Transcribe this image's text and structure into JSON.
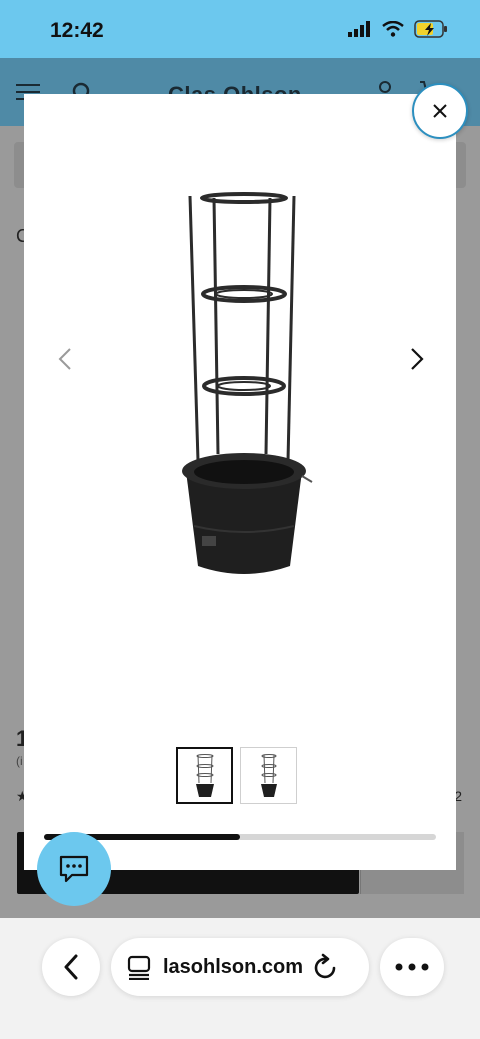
{
  "status_bar": {
    "time": "12:42",
    "icons": [
      "signal-icon",
      "wifi-icon",
      "battery-charging-icon"
    ]
  },
  "header": {
    "brand": "Clas Ohlson",
    "icons": [
      "menu-icon",
      "search-icon",
      "user-icon",
      "cart-icon"
    ]
  },
  "background_page": {
    "price": "1",
    "small_text": "(i",
    "stars": "★",
    "count": "2",
    "prefix_char": "C"
  },
  "modal": {
    "image_alt": "Black plant pot with tomato support tower",
    "thumbnails": [
      "thumbnail-1",
      "thumbnail-2"
    ],
    "selected_thumbnail": 0,
    "carousel_progress": 0.5
  },
  "browser": {
    "url": "lasohlson.com"
  },
  "colors": {
    "status_bar": "#6cc8ee",
    "header": "#4f8aa6",
    "accent": "#2c8fbf"
  }
}
